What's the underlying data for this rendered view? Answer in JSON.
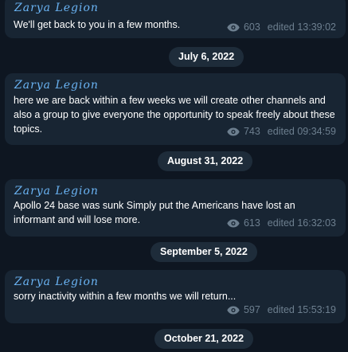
{
  "messages": [
    {
      "author": "Zarya Legion",
      "text": "We'll get back to you in a few months.",
      "views": "603",
      "time": "edited 13:39:02"
    },
    {
      "author": "Zarya Legion",
      "text": "here we are back within a few weeks we will create other channels and also a group to give everyone the opportunity to speak freely about these topics.",
      "views": "743",
      "time": "edited 09:34:59"
    },
    {
      "author": "Zarya Legion",
      "text": "Apollo 24 base was sunk Simply put the Americans have lost an informant and will lose more.",
      "views": "613",
      "time": "edited 16:32:03"
    },
    {
      "author": "Zarya Legion",
      "text": "sorry inactivity within a few months we will return...",
      "views": "597",
      "time": "edited 15:53:19"
    }
  ],
  "date_separators": [
    "July 6, 2022",
    "August 31, 2022",
    "September 5, 2022",
    "October 21, 2022"
  ],
  "colors": {
    "background": "#0e1621",
    "bubble": "#182533",
    "author": "#6ab3f3",
    "text": "#ffffff",
    "meta": "#6d7f8f",
    "date_pill": "#1e2c3a"
  },
  "icons": {
    "views": "eye-icon"
  }
}
